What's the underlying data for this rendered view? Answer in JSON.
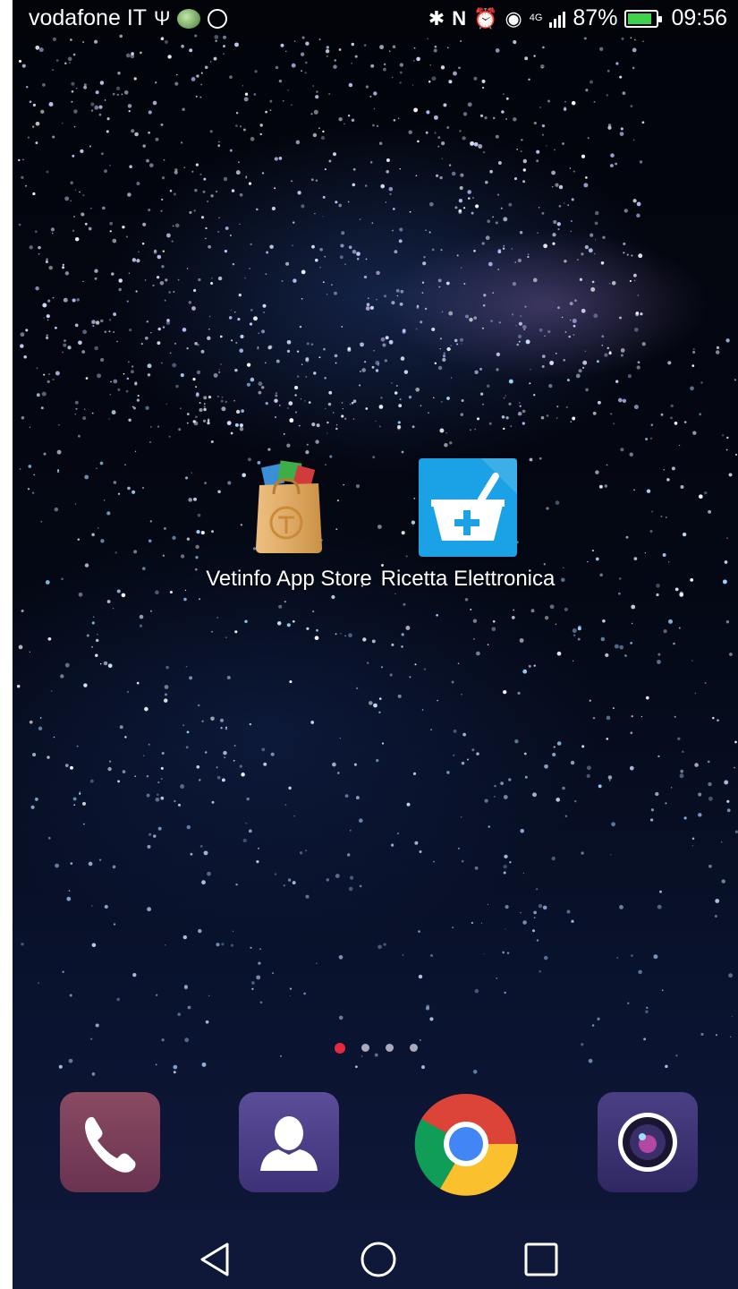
{
  "status_bar": {
    "carrier": "vodafone IT",
    "network": "4G",
    "battery_percent": "87%",
    "battery_level": 0.87,
    "time": "09:56",
    "left_icons": [
      "usb-icon",
      "photo-thumbnail-icon",
      "whatsapp-icon"
    ],
    "right_icons": [
      "bluetooth-icon",
      "nfc-icon",
      "alarm-icon",
      "eye-comfort-icon",
      "signal-icon",
      "battery-icon"
    ]
  },
  "home": {
    "apps": [
      {
        "label": "Vetinfo App Store",
        "icon": "shopping-bag-icon"
      },
      {
        "label": "Ricetta Elettronica",
        "icon": "mortar-plus-icon"
      }
    ],
    "page_indicator": {
      "pages": 4,
      "current": 1
    }
  },
  "dock": {
    "items": [
      {
        "name": "phone",
        "icon": "phone-icon"
      },
      {
        "name": "contacts",
        "icon": "contacts-icon"
      },
      {
        "name": "chrome",
        "icon": "chrome-icon"
      },
      {
        "name": "camera",
        "icon": "camera-icon"
      }
    ]
  },
  "nav_bar": {
    "buttons": [
      "back",
      "home",
      "recent-apps"
    ]
  },
  "colors": {
    "accent_dot": "#e6283c",
    "ricetta_blue": "#1aa1e6",
    "phone_tile": "#7a3f5a",
    "contacts_tile": "#4d4088",
    "camera_tile": "#3c3372",
    "battery_green": "#3ed14a"
  }
}
